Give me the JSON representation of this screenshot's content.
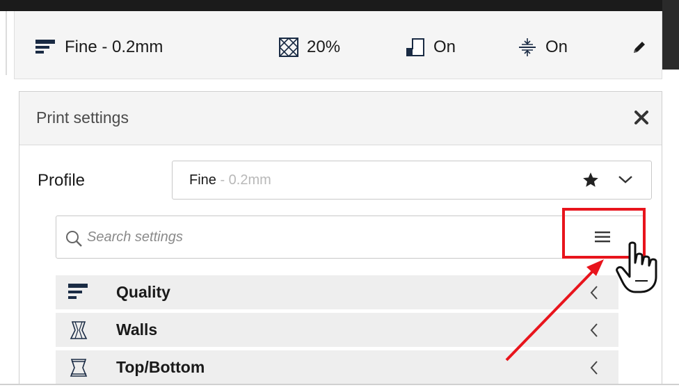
{
  "colors": {
    "accent_red": "#e8141c",
    "header_bg": "#f5f5f5",
    "row_bg": "#eeeeee",
    "muted_text": "#b8b8b8"
  },
  "header": {
    "profile": {
      "icon": "quality-bars-icon",
      "label": "Fine - 0.2mm"
    },
    "infill": {
      "icon": "infill-icon",
      "label": "20%"
    },
    "support": {
      "icon": "support-icon",
      "label": "On"
    },
    "adhesion": {
      "icon": "adhesion-icon",
      "label": "On"
    },
    "edit": {
      "icon": "pencil-icon"
    }
  },
  "panel": {
    "title": "Print settings",
    "close_icon": "close-icon",
    "profile_label": "Profile",
    "profile_select": {
      "name": "Fine",
      "sub": " - 0.2mm",
      "star_icon": "star-icon",
      "chevron_icon": "chevron-down-icon"
    },
    "search": {
      "placeholder": "Search settings",
      "icon": "search-icon",
      "menu_icon": "hamburger-menu-icon"
    },
    "categories": [
      {
        "label": "Quality",
        "icon": "quality-bars-icon"
      },
      {
        "label": "Walls",
        "icon": "walls-icon"
      },
      {
        "label": "Top/Bottom",
        "icon": "top-bottom-icon"
      }
    ]
  },
  "annotation": {
    "highlight": "red-highlight-box",
    "arrow": "red-arrow",
    "cursor": "hand-pointer-icon"
  }
}
